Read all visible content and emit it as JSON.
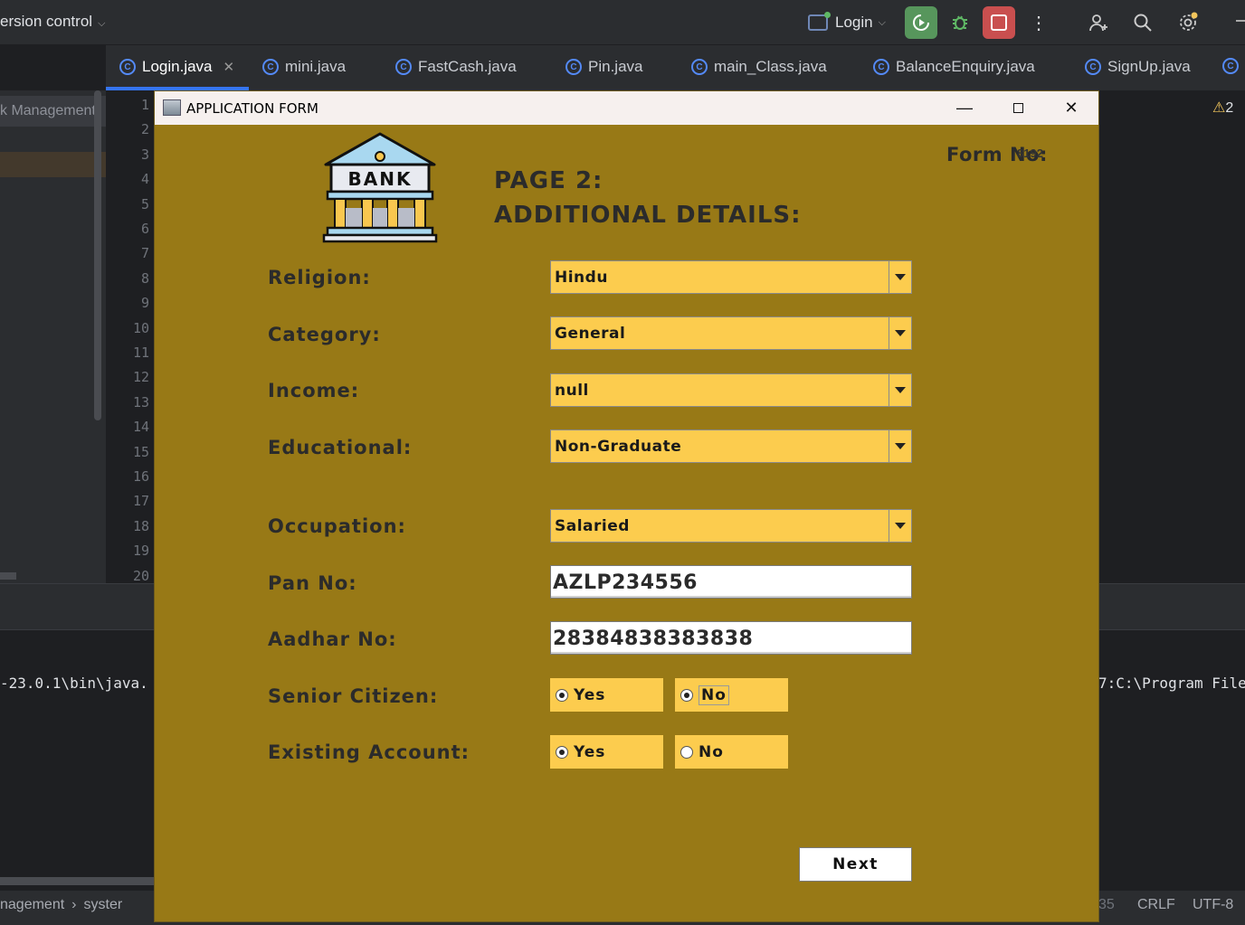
{
  "ide": {
    "version_control": "ersion control",
    "run_config": "Login",
    "tabs": [
      "Login.java",
      "mini.java",
      "FastCash.java",
      "Pin.java",
      "main_Class.java",
      "BalanceEnquiry.java",
      "SignUp.java"
    ],
    "project_label": "k Management",
    "line_numbers": [
      "1",
      "2",
      "3",
      "4",
      "5",
      "6",
      "7",
      "8",
      "9",
      "10",
      "11",
      "12",
      "13",
      "14",
      "15",
      "16",
      "17",
      "18",
      "19",
      "20"
    ],
    "warning_count": "2",
    "console_left": "-23.0.1\\bin\\java.",
    "console_right": "7:C:\\Program File",
    "status": {
      "crumb_1": "nagement",
      "crumb_2": "syster",
      "position": "35",
      "line_sep": "CRLF",
      "encoding": "UTF-8"
    }
  },
  "window": {
    "title": "APPLICATION FORM",
    "form_no_label": "Form No:",
    "form_no_value": "8192",
    "heading_1": "PAGE 2:",
    "heading_2": "ADDITIONAL DETAILS:",
    "logo_text": "BANK",
    "fields": {
      "religion": {
        "label": "Religion:",
        "value": "Hindu"
      },
      "category": {
        "label": "Category:",
        "value": "General"
      },
      "income": {
        "label": "Income:",
        "value": "null"
      },
      "educational": {
        "label": "Educational:",
        "value": "Non-Graduate"
      },
      "occupation": {
        "label": "Occupation:",
        "value": "Salaried"
      },
      "pan": {
        "label": "Pan No:",
        "value": "AZLP234556"
      },
      "aadhar": {
        "label": "Aadhar No:",
        "value": "28384838383838"
      },
      "senior": {
        "label": "Senior Citizen:",
        "yes": "Yes",
        "no": "No"
      },
      "existing": {
        "label": "Existing Account:",
        "yes": "Yes",
        "no": "No"
      }
    },
    "next_label": "Next"
  },
  "colors": {
    "form_bg": "#987916",
    "field_bg": "#fccc4e",
    "text_dark": "#2b2b2b"
  }
}
